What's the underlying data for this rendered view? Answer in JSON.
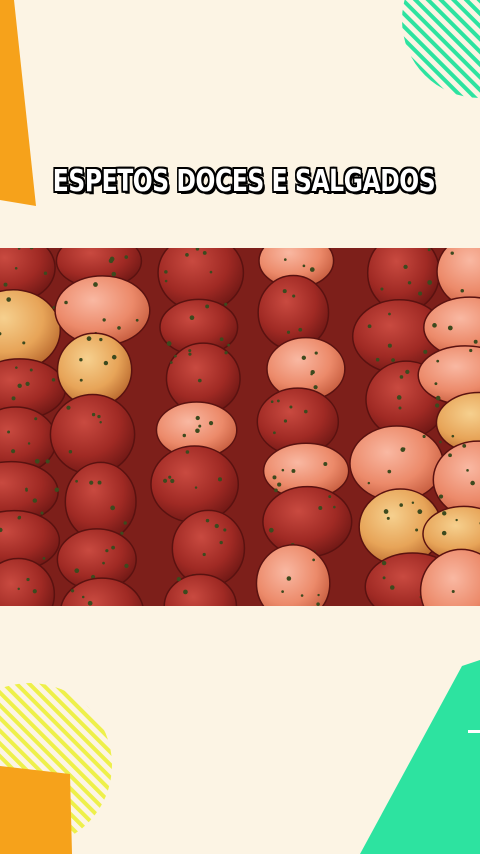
{
  "title": "ESPETOS DOCES E SALGADOS",
  "colors": {
    "background": "#fcf4e4",
    "orange": "#f6a21b",
    "green": "#2de3a0",
    "yellow": "#eef04a",
    "meat": "#a8322b",
    "chicken": "#e9a35a"
  },
  "photo": {
    "subject": "raw marinated meat and chicken skewers"
  }
}
